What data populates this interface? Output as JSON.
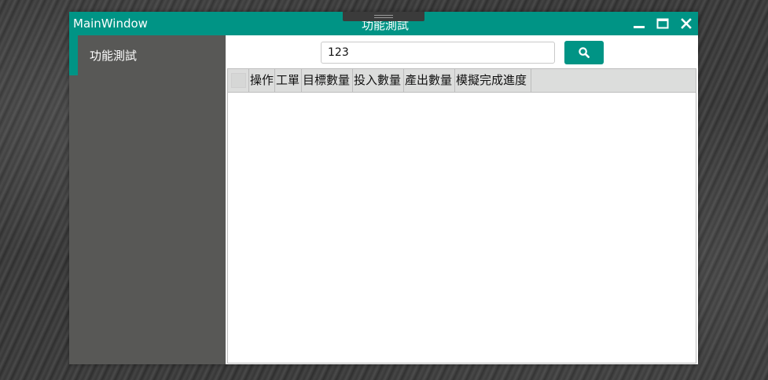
{
  "window": {
    "app_title": "MainWindow",
    "page_title": "功能測試",
    "accent_color": "#009485",
    "controls": [
      "minimize-icon",
      "maximize-icon",
      "close-icon"
    ]
  },
  "sidebar": {
    "background_color": "#585856",
    "items": [
      {
        "label": "功能測試",
        "selected": true
      }
    ]
  },
  "search": {
    "value": "123",
    "button_icon": "search-icon"
  },
  "grid": {
    "columns": [
      "操作",
      "工單",
      "目標數量",
      "投入數量",
      "產出數量",
      "模擬完成進度"
    ],
    "rows": []
  }
}
